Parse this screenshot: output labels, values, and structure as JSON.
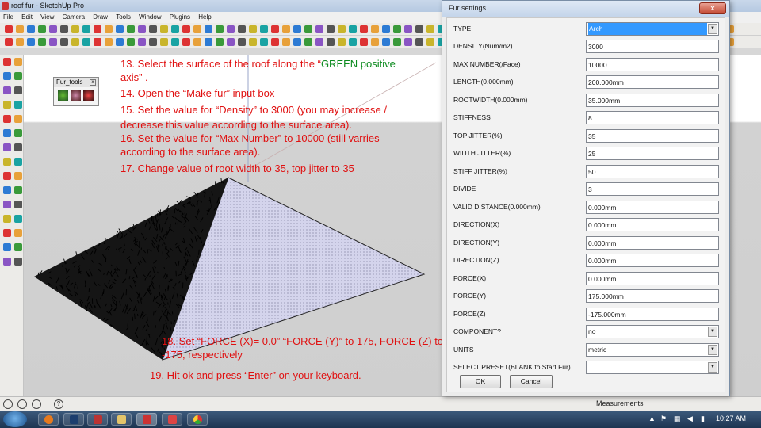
{
  "window": {
    "title": "roof fur - SketchUp Pro"
  },
  "menubar": [
    "File",
    "Edit",
    "View",
    "Camera",
    "Draw",
    "Tools",
    "Window",
    "Plugins",
    "Help"
  ],
  "fur_tools": {
    "title": "Fur_tools",
    "close": "x"
  },
  "instructions": {
    "step13_a": "13. Select the surface of the roof along the “",
    "step13_green": "GREEN positive",
    "step13_b": "axis” .",
    "step14": "14. Open the “Make fur” input box",
    "step15_a": "15. Set the value for “Density” to 3000 (you may increase /",
    "step15_b": "decrease this value according to the surface area).",
    "step16_a": "16. Set the value for “Max Number” to 10000 (still varries",
    "step16_b": "according to the surface area).",
    "step17": "17. Change value of root width to 35, top jitter to 35",
    "step18_a": "18. Set “FORCE (X)= 0.0” “FORCE (Y)” to 175, FORCE (Z) to",
    "step18_b": "-175, respectively",
    "step19": "19. Hit ok and press “Enter” on your keyboard."
  },
  "dialog": {
    "title": "Fur settings.",
    "close": "x",
    "fields": [
      {
        "label": "TYPE",
        "value": "Arch"
      },
      {
        "label": "DENSITY(Num/m2)",
        "value": "3000"
      },
      {
        "label": "MAX NUMBER(/Face)",
        "value": "10000"
      },
      {
        "label": "LENGTH(0.000mm)",
        "value": "200.000mm"
      },
      {
        "label": "ROOTWIDTH(0.000mm)",
        "value": "35.000mm"
      },
      {
        "label": "STIFFNESS",
        "value": "8"
      },
      {
        "label": "TOP JITTER(%)",
        "value": "35"
      },
      {
        "label": "WIDTH JITTER(%)",
        "value": "25"
      },
      {
        "label": "STIFF JITTER(%)",
        "value": "50"
      },
      {
        "label": "DIVIDE",
        "value": "3"
      },
      {
        "label": "VALID DISTANCE(0.000mm)",
        "value": "0.000mm"
      },
      {
        "label": "DIRECTION(X)",
        "value": "0.000mm"
      },
      {
        "label": "DIRECTION(Y)",
        "value": "0.000mm"
      },
      {
        "label": "DIRECTION(Z)",
        "value": "0.000mm"
      },
      {
        "label": "FORCE(X)",
        "value": "0.000mm"
      },
      {
        "label": "FORCE(Y)",
        "value": "175.000mm"
      },
      {
        "label": "FORCE(Z)",
        "value": "-175.000mm"
      },
      {
        "label": "COMPONENT?",
        "value": "no"
      },
      {
        "label": "UNITS",
        "value": "metric"
      },
      {
        "label": "SELECT PRESET(BLANK to Start Fur)",
        "value": ""
      }
    ],
    "ok_label": "OK",
    "cancel_label": "Cancel"
  },
  "status_bar": {
    "measurements_label": "Measurements",
    "help_glyph": "?"
  },
  "taskbar": {
    "clock": "10:27 AM"
  },
  "colors": {
    "instruction_text": "#e01010",
    "instruction_green": "#0b8a1e",
    "selected_highlight": "#3399ff",
    "close_button": "#c44a33",
    "taskbar": "#1e3551"
  }
}
